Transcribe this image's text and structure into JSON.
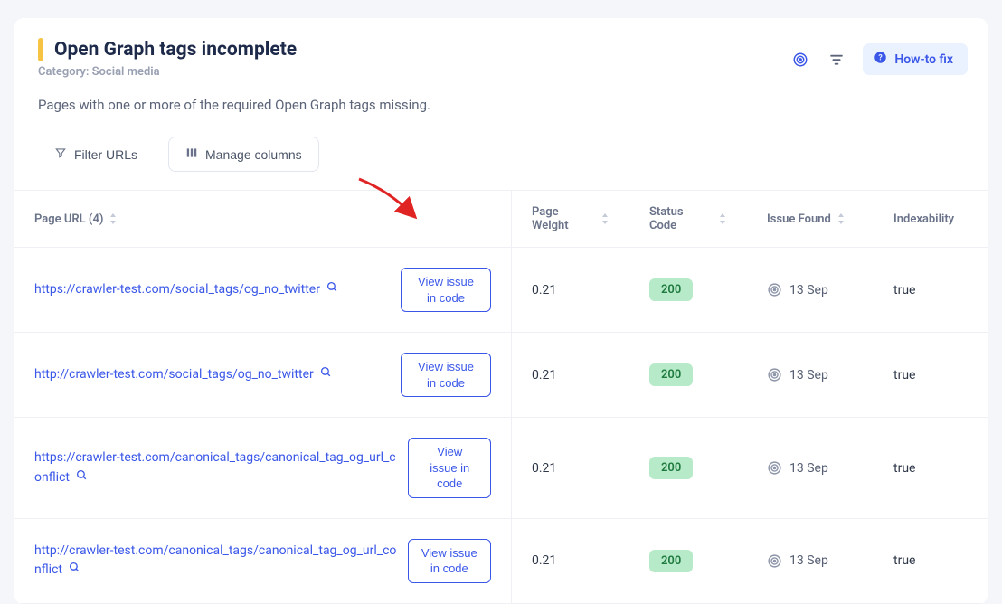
{
  "header": {
    "title": "Open Graph tags incomplete",
    "category": "Category: Social media",
    "description": "Pages with one or more of the required Open Graph tags missing.",
    "howto_label": "How-to fix"
  },
  "toolbar": {
    "filter_label": "Filter URLs",
    "columns_label": "Manage columns"
  },
  "table": {
    "headers": {
      "url": "Page URL (4)",
      "weight": "Page Weight",
      "status": "Status Code",
      "found": "Issue Found",
      "index": "Indexability"
    },
    "view_issue_label": "View issue in code",
    "rows": [
      {
        "url": "https://crawler-test.com/social_tags/og_no_twitter",
        "weight": "0.21",
        "status": "200",
        "found": "13 Sep",
        "index": "true"
      },
      {
        "url": "http://crawler-test.com/social_tags/og_no_twitter",
        "weight": "0.21",
        "status": "200",
        "found": "13 Sep",
        "index": "true"
      },
      {
        "url": "https://crawler-test.com/canonical_tags/canonical_tag_og_url_conflict",
        "weight": "0.21",
        "status": "200",
        "found": "13 Sep",
        "index": "true"
      },
      {
        "url": "http://crawler-test.com/canonical_tags/canonical_tag_og_url_conflict",
        "weight": "0.21",
        "status": "200",
        "found": "13 Sep",
        "index": "true"
      }
    ]
  },
  "colors": {
    "warning_bar": "#f6c343",
    "primary": "#3a57e8",
    "success_bg": "#b7eac8",
    "success_fg": "#1f7a3f"
  }
}
